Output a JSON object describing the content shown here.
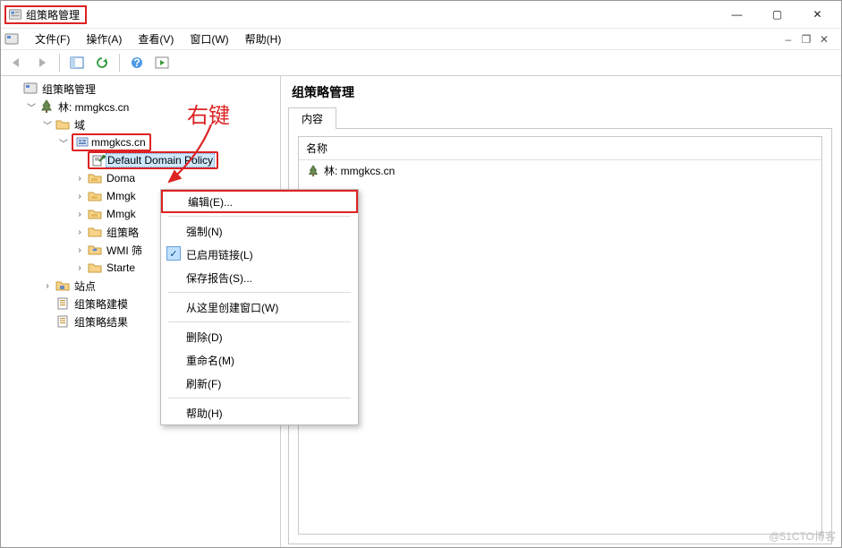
{
  "window": {
    "title": "组策略管理",
    "controls": {
      "min": "—",
      "max": "▢",
      "close": "✕"
    }
  },
  "menubar": {
    "items": [
      "文件(F)",
      "操作(A)",
      "查看(V)",
      "窗口(W)",
      "帮助(H)"
    ]
  },
  "tree": {
    "root": {
      "label": "组策略管理"
    },
    "forest": {
      "label": "林: mmgkcs.cn"
    },
    "domains": {
      "label": "域"
    },
    "domain": {
      "label": "mmgkcs.cn"
    },
    "items": [
      {
        "label": "Default Domain Policy",
        "selected": true
      },
      {
        "label": "Doma"
      },
      {
        "label": "Mmgk"
      },
      {
        "label": "Mmgk"
      },
      {
        "label": "组策略"
      },
      {
        "label": "WMI 筛"
      },
      {
        "label": "Starte"
      }
    ],
    "sites": {
      "label": "站点"
    },
    "gpmodel": {
      "label": "组策略建模"
    },
    "gpresult": {
      "label": "组策略结果"
    }
  },
  "content": {
    "title": "组策略管理",
    "tab": "内容",
    "column": "名称",
    "row0": "林: mmgkcs.cn"
  },
  "context_menu": {
    "edit": "编辑(E)...",
    "enforce": "强制(N)",
    "link_enabled": "已启用链接(L)",
    "save_report": "保存报告(S)...",
    "new_window": "从这里创建窗口(W)",
    "delete": "删除(D)",
    "rename": "重命名(M)",
    "refresh": "刷新(F)",
    "help": "帮助(H)"
  },
  "annotation": {
    "label": "右键"
  },
  "watermark": "@51CTO博客"
}
